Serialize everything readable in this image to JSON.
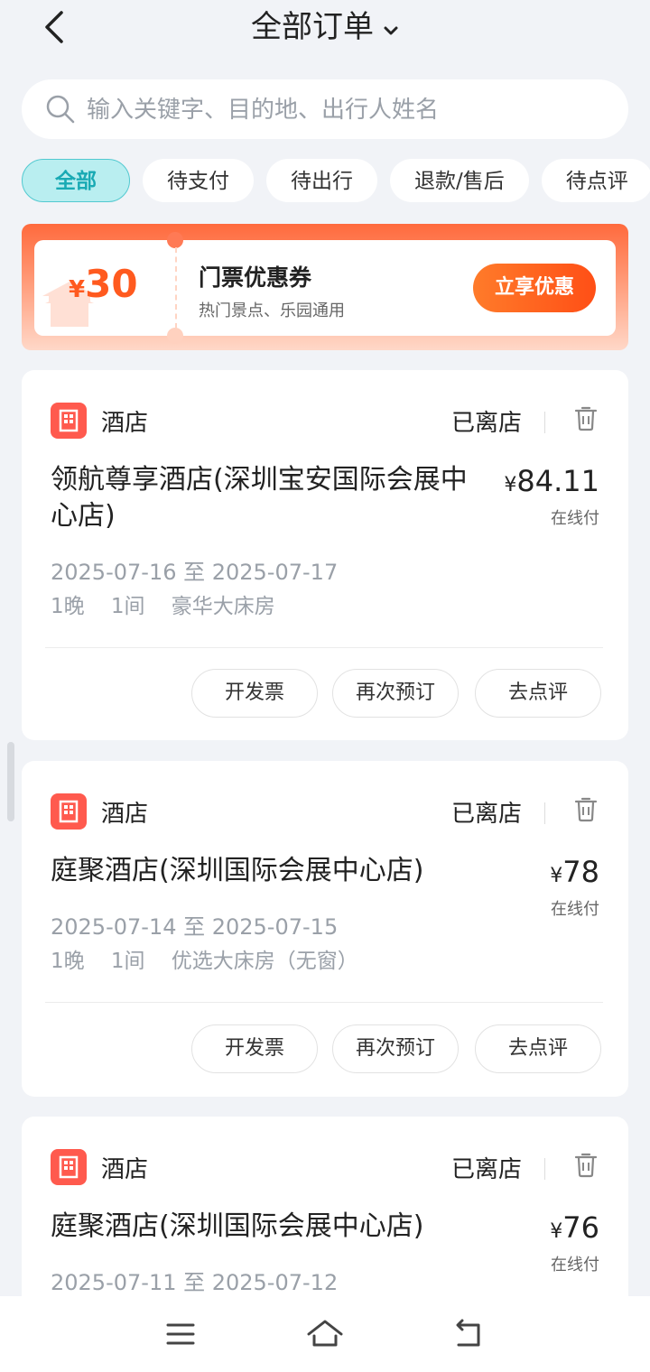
{
  "header": {
    "title": "全部订单",
    "back_icon": "chevron-left-icon",
    "dropdown_icon": "chevron-down-icon"
  },
  "search": {
    "placeholder": "输入关键字、目的地、出行人姓名",
    "value": ""
  },
  "tabs": [
    {
      "label": "全部",
      "active": true
    },
    {
      "label": "待支付",
      "active": false
    },
    {
      "label": "待出行",
      "active": false
    },
    {
      "label": "退款/售后",
      "active": false
    },
    {
      "label": "待点评",
      "active": false
    }
  ],
  "coupon": {
    "currency": "¥",
    "amount": "30",
    "name": "门票优惠券",
    "desc": "热门景点、乐园通用",
    "cta": "立享优惠",
    "accent": "#ff5a1f"
  },
  "orders": [
    {
      "type": "酒店",
      "status": "已离店",
      "name": "领航尊享酒店(深圳宝安国际会展中心店)",
      "currency": "¥",
      "price": "84.11",
      "pay": "在线付",
      "dates": "2025-07-16 至 2025-07-17",
      "room": "1晚    1间    豪华大床房",
      "actions": [
        "开发票",
        "再次预订",
        "去点评"
      ]
    },
    {
      "type": "酒店",
      "status": "已离店",
      "name": "庭聚酒店(深圳国际会展中心店)",
      "currency": "¥",
      "price": "78",
      "pay": "在线付",
      "dates": "2025-07-14 至 2025-07-15",
      "room": "1晚    1间    优选大床房（无窗）",
      "actions": [
        "开发票",
        "再次预订",
        "去点评"
      ]
    },
    {
      "type": "酒店",
      "status": "已离店",
      "name": "庭聚酒店(深圳国际会展中心店)",
      "currency": "¥",
      "price": "76",
      "pay": "在线付",
      "dates": "2025-07-11 至 2025-07-12"
    }
  ],
  "nav": {
    "menu_icon": "menu-icon",
    "home_icon": "home-icon",
    "back_icon": "back-icon"
  },
  "colors": {
    "accent": "#19aab4",
    "hotel_icon": "#ff5a4e",
    "background": "#f1f3f7"
  }
}
